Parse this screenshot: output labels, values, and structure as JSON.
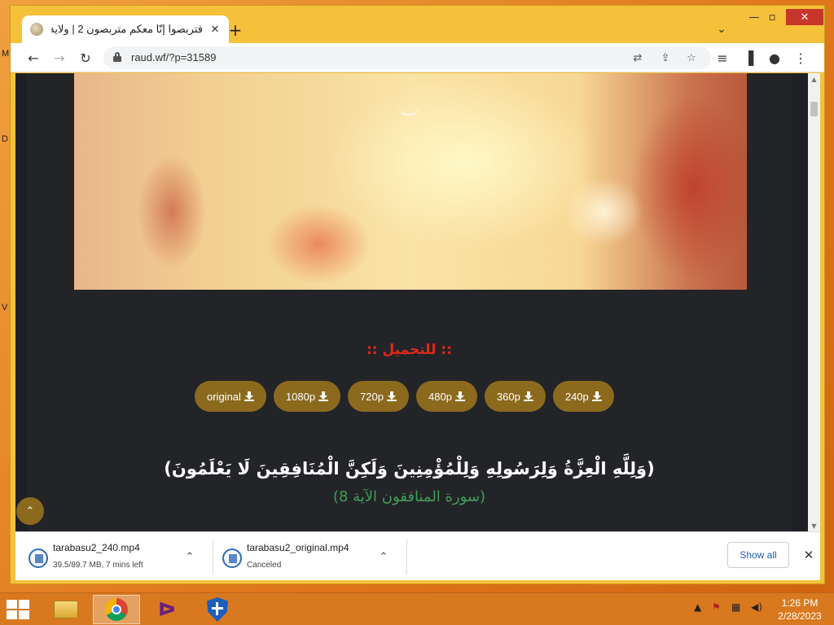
{
  "browser": {
    "tab_title": "فتربصوا إنّا معكم متربصون 2 | ولاية",
    "url": "raud.wf/?p=31589",
    "new_tab": "+",
    "close_tab": "✕"
  },
  "page": {
    "download_heading": ":: للتحميل ::",
    "download_buttons": [
      "original",
      "1080p",
      "720p",
      "480p",
      "360p",
      "240p"
    ],
    "verse": "(وَلِلَّهِ الْعِزَّةُ وَلِرَسُولِهِ وَلِلْمُؤْمِنِينَ وَلَكِنَّ الْمُنَافِقِينَ لَا يَعْلَمُونَ)",
    "verse_reference": "(سورة المنافقون الآية 8)"
  },
  "downloads": [
    {
      "name": "tarabasu2_240.mp4",
      "status": "39.5/89.7 MB, 7 mins left"
    },
    {
      "name": "tarabasu2_original.mp4",
      "status": "Canceled"
    }
  ],
  "downloads_show_all": "Show all",
  "taskbar": {
    "time": "1:26 PM",
    "date": "2/28/2023",
    "apps": [
      "file-explorer",
      "chrome",
      "visual-studio",
      "windows-defender"
    ]
  },
  "desktop_glyphs": [
    "M",
    "D",
    "V"
  ]
}
